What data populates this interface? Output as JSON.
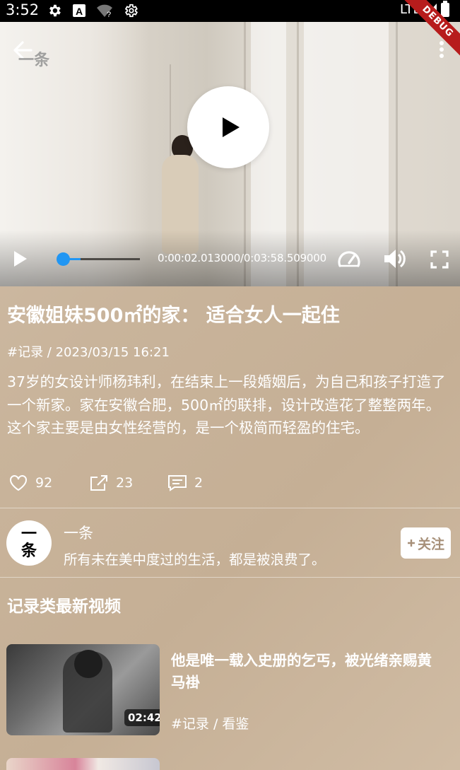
{
  "status_bar": {
    "time": "3:52",
    "network": "LTE",
    "debug_banner": "DEBUG",
    "icons": [
      "gear-icon",
      "a-icon",
      "wifi-question-icon",
      "gear-icon",
      "signal-icon",
      "battery-icon"
    ]
  },
  "video": {
    "watermark": "一条",
    "position": "0:00:02.013000",
    "duration": "0:03:58.509000",
    "time_display": "0:00:02.013000/0:03:58.509000",
    "progress": 0.0085
  },
  "article": {
    "title": "安徽姐妹500㎡的家： 适合女人一起住",
    "meta": "#记录 / 2023/03/15 16:21",
    "description": "37岁的女设计师杨玮利，在结束上一段婚姻后，为自己和孩子打造了一个新家。家在安徽合肥，500㎡的联排，设计改造花了整整两年。这个家主要是由女性经营的，是一个极简而轻盈的住宅。",
    "likes": "92",
    "shares": "23",
    "comments": "2"
  },
  "author": {
    "avatar_text": "一条",
    "name": "一条",
    "bio": "所有未在美中度过的生活，都是被浪费了。",
    "follow_label": "关注"
  },
  "related": {
    "section_title": "记录类最新视频",
    "items": [
      {
        "title": "他是唯一载入史册的乞丐，被光绪亲赐黄马褂",
        "meta": "#记录 / 看鉴",
        "duration": "02:42"
      }
    ]
  },
  "colors": {
    "accent": "#2196f3",
    "background": "#c9b49b",
    "follow_text": "#a79079"
  }
}
